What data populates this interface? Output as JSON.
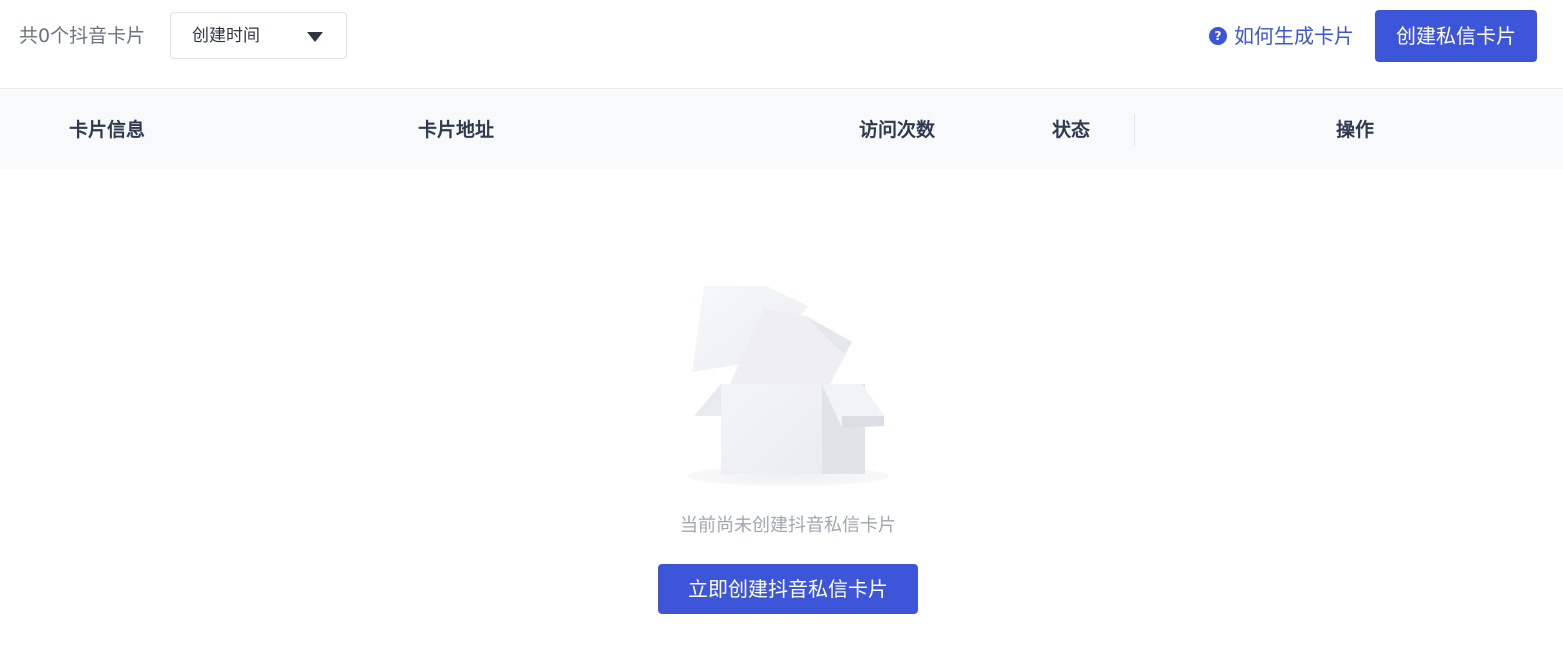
{
  "toolbar": {
    "count_label": "共0个抖音卡片",
    "sort_value": "创建时间",
    "help_text": "如何生成卡片",
    "help_icon": "?",
    "create_button": "创建私信卡片"
  },
  "table": {
    "columns": [
      "卡片信息",
      "卡片地址",
      "访问次数",
      "状态",
      "操作"
    ]
  },
  "empty_state": {
    "message": "当前尚未创建抖音私信卡片",
    "button": "立即创建抖音私信卡片",
    "illustration": "empty-box-icon"
  },
  "colors": {
    "primary": "#3d55d9",
    "header_bg": "#f7f9fb",
    "muted_text": "#a0a6b1"
  }
}
